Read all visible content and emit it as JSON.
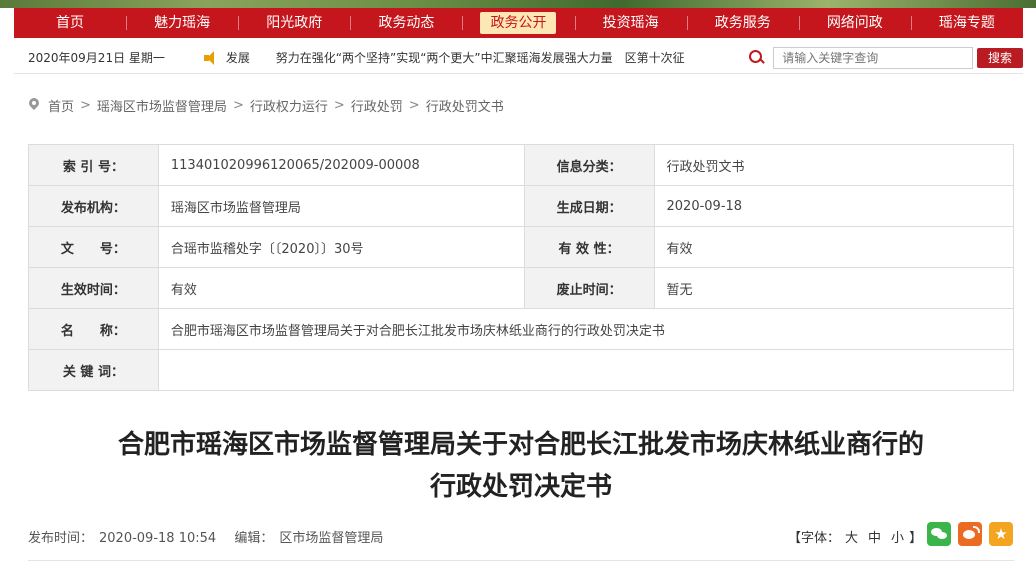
{
  "nav": {
    "items": [
      "首页",
      "魅力瑶海",
      "阳光政府",
      "政务动态",
      "政务公开",
      "投资瑶海",
      "政务服务",
      "网络问政",
      "瑶海专题"
    ],
    "active": "政务公开"
  },
  "infobar": {
    "date": "2020年09月21日 星期一",
    "news_label": "发展",
    "ticker": "努力在强化“两个坚持”实现“两个更大”中汇聚瑶海发展强大力量　区第十次征",
    "search_placeholder": "请输入关键字查询",
    "search_button": "搜索"
  },
  "breadcrumb": [
    "首页",
    "瑶海区市场监督管理局",
    "行政权力运行",
    "行政处罚",
    "行政处罚文书"
  ],
  "meta": {
    "index_label": "索 引 号：",
    "index_value": "113401020996120065/202009-00008",
    "category_label": "信息分类：",
    "category_value": "行政处罚文书",
    "publisher_label": "发布机构：",
    "publisher_value": "瑶海区市场监督管理局",
    "gen_date_label": "生成日期：",
    "gen_date_value": "2020-09-18",
    "doc_no_label": "文　　号：",
    "doc_no_value": "合瑶市监稽处字〔〔2020〕〕30号",
    "validity_label": "有 效 性：",
    "validity_value": "有效",
    "effective_label": "生效时间：",
    "effective_value": "有效",
    "expire_label": "废止时间：",
    "expire_value": "暂无",
    "name_label": "名　　称：",
    "name_value": "合肥市瑶海区市场监督管理局关于对合肥长江批发市场庆林纸业商行的行政处罚决定书",
    "keywords_label": "关 键 词：",
    "keywords_value": ""
  },
  "article": {
    "title_line1": "合肥市瑶海区市场监督管理局关于对合肥长江批发市场庆林纸业商行的",
    "title_line2": "行政处罚决定书",
    "publish_label": "发布时间：",
    "publish_time": "2020-09-18 10:54",
    "editor_label": "编辑：",
    "editor": "区市场监督管理局"
  },
  "fontsize": {
    "prefix": "【字体：",
    "large": "大",
    "medium": "中",
    "small": "小",
    "suffix": "】"
  },
  "colors": {
    "brand_red": "#c4161c",
    "wechat": "#3bb44a",
    "weibo": "#ec6b23",
    "favorite": "#f3a521"
  }
}
